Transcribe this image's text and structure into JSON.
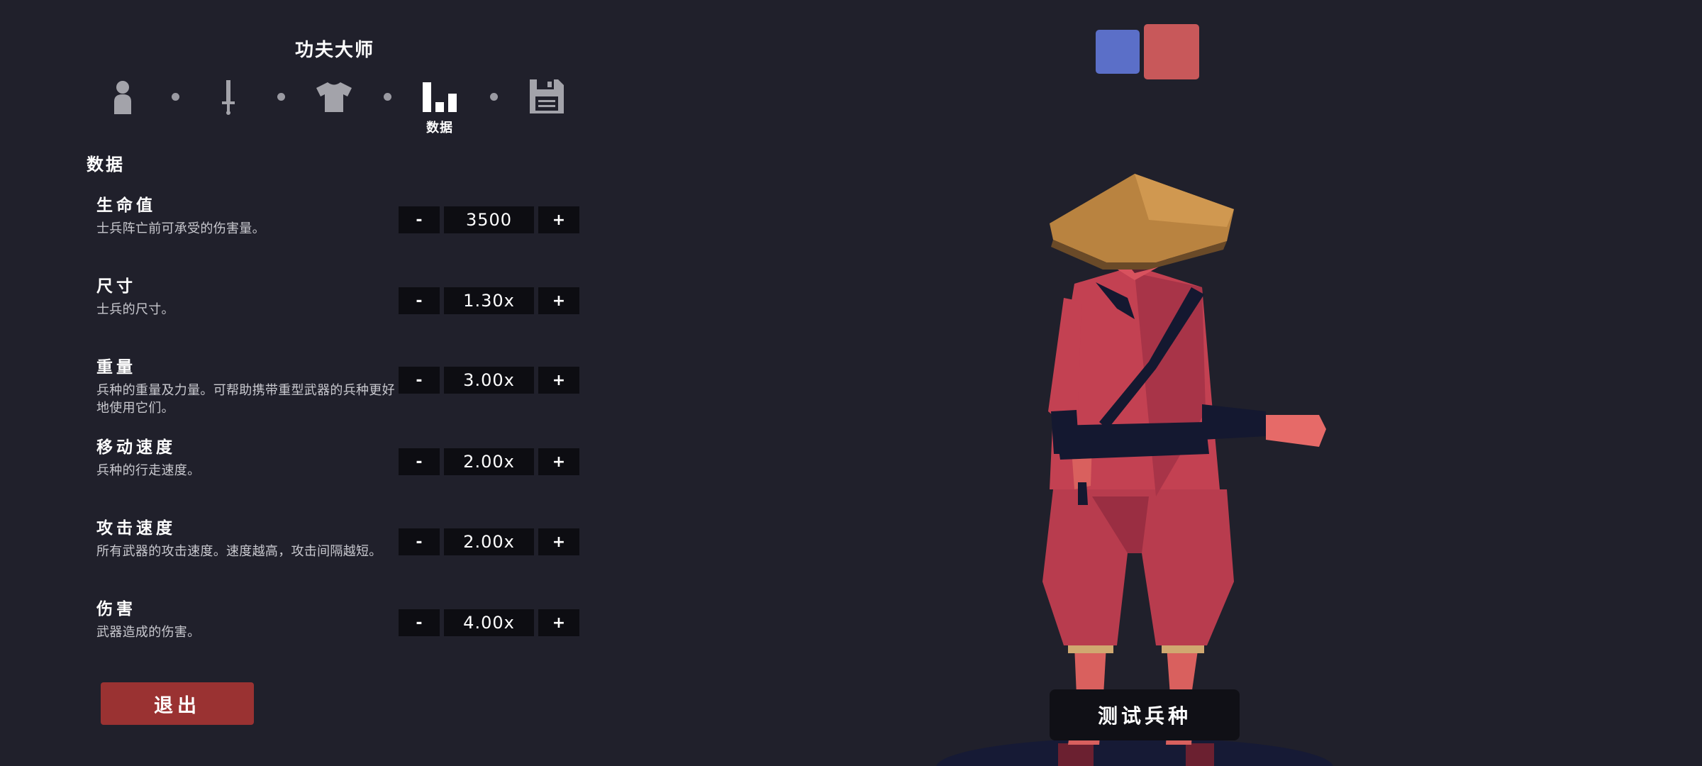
{
  "unit_title": "功夫大师",
  "steps": [
    {
      "icon": "person-icon",
      "label": ""
    },
    {
      "icon": "sword-icon",
      "label": ""
    },
    {
      "icon": "shirt-icon",
      "label": ""
    },
    {
      "icon": "bar-chart-icon",
      "label": "数据"
    },
    {
      "icon": "save-icon",
      "label": ""
    }
  ],
  "section_title": "数据",
  "stats": [
    {
      "name": "生命值",
      "desc": "士兵阵亡前可承受的伤害量。",
      "value": "3500"
    },
    {
      "name": "尺寸",
      "desc": "士兵的尺寸。",
      "value": "1.30x"
    },
    {
      "name": "重量",
      "desc": "兵种的重量及力量。可帮助携带重型武器的兵种更好地使用它们。",
      "value": "3.00x"
    },
    {
      "name": "移动速度",
      "desc": "兵种的行走速度。",
      "value": "2.00x"
    },
    {
      "name": "攻击速度",
      "desc": "所有武器的攻击速度。速度越高，攻击间隔越短。",
      "value": "2.00x"
    },
    {
      "name": "伤害",
      "desc": "武器造成的伤害。",
      "value": "4.00x"
    }
  ],
  "minus_label": "-",
  "plus_label": "+",
  "exit_label": "退出",
  "test_label": "测试兵种",
  "team_colors": {
    "blue": "#5b6fc8",
    "red": "#c8585a"
  },
  "colors": {
    "background": "#20202b",
    "exit_button": "#9a3232",
    "button_dark": "#0d0d12"
  }
}
